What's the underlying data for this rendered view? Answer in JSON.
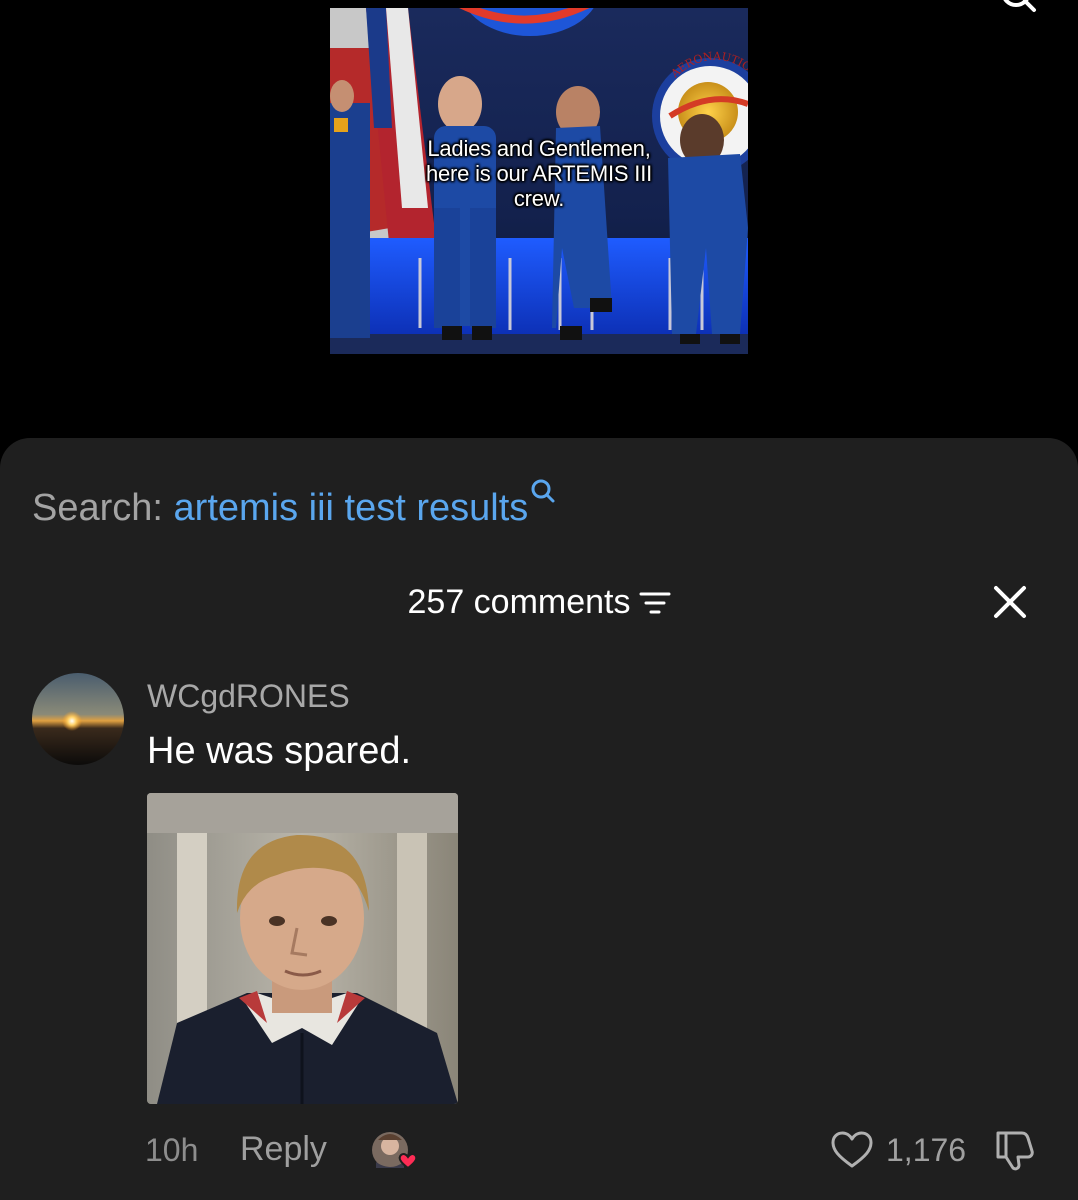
{
  "video": {
    "caption": "Ladies and Gentlemen,\nhere is our ARTEMIS III\ncrew.",
    "seal_text": "AERONAUTICS"
  },
  "search": {
    "prefix": "Search:",
    "query": "artemis iii test results"
  },
  "comments_panel": {
    "count_label": "257 comments"
  },
  "comment": {
    "username": "WCgdRONES",
    "text": "He was spared.",
    "time": "10h",
    "reply_label": "Reply",
    "like_count": "1,176"
  },
  "colors": {
    "sheet_background": "#1f1f1f",
    "search_link": "#5aa6ee",
    "muted_text": "#a3a3a3",
    "heart_badge": "#fe2c55"
  }
}
